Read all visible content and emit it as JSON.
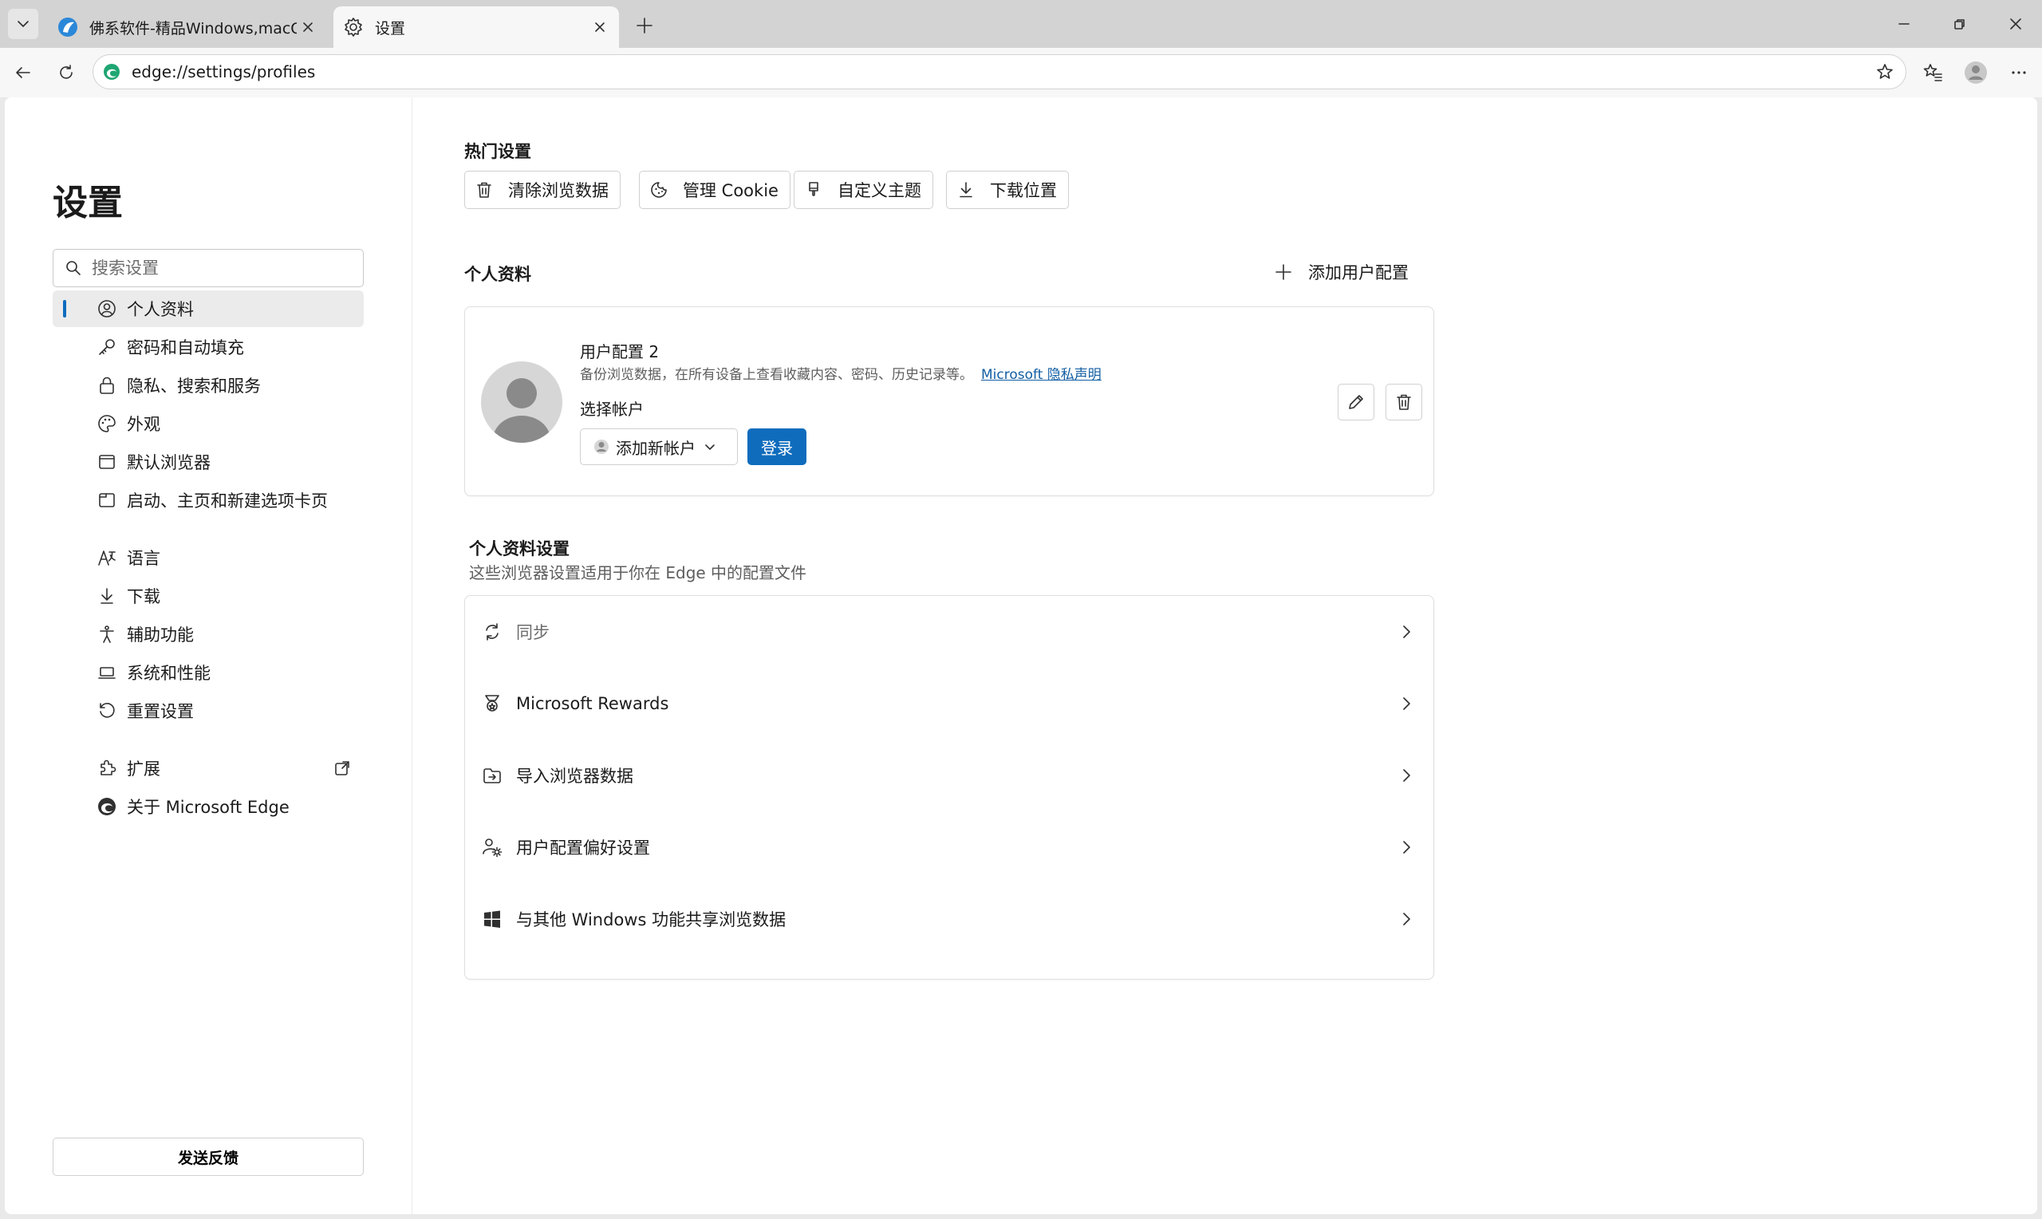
{
  "browser": {
    "tabs": [
      {
        "title": "佛系软件-精品Windows,macOS破解",
        "active": false
      },
      {
        "title": "设置",
        "active": true
      }
    ],
    "address": "edge://settings/profiles"
  },
  "sidebar": {
    "title": "设置",
    "search_placeholder": "搜索设置",
    "items": [
      {
        "label": "个人资料",
        "icon": "profile-icon",
        "active": true
      },
      {
        "label": "密码和自动填充",
        "icon": "key-icon"
      },
      {
        "label": "隐私、搜索和服务",
        "icon": "lock-icon"
      },
      {
        "label": "外观",
        "icon": "palette-icon"
      },
      {
        "label": "默认浏览器",
        "icon": "browser-icon"
      },
      {
        "label": "启动、主页和新建选项卡页",
        "icon": "home-tabs-icon"
      },
      {
        "label": "语言",
        "icon": "language-icon"
      },
      {
        "label": "下载",
        "icon": "download-icon"
      },
      {
        "label": "辅助功能",
        "icon": "accessibility-icon"
      },
      {
        "label": "系统和性能",
        "icon": "laptop-icon"
      },
      {
        "label": "重置设置",
        "icon": "reset-icon"
      },
      {
        "label": "扩展",
        "icon": "puzzle-icon"
      },
      {
        "label": "关于 Microsoft Edge",
        "icon": "edge-logo-icon"
      }
    ],
    "feedback_label": "发送反馈"
  },
  "main": {
    "hot_settings_title": "热门设置",
    "quick_buttons": [
      {
        "label": "清除浏览数据",
        "icon": "trash-icon"
      },
      {
        "label": "管理 Cookie",
        "icon": "cookie-icon"
      },
      {
        "label": "自定义主题",
        "icon": "brush-icon"
      },
      {
        "label": "下载位置",
        "icon": "download-icon"
      }
    ],
    "profiles_title": "个人资料",
    "add_profile_label": "添加用户配置",
    "profile": {
      "name": "用户配置 2",
      "description": "备份浏览数据，在所有设备上查看收藏内容、密码、历史记录等。",
      "privacy_link": "Microsoft 隐私声明",
      "choose_account_label": "选择帐户",
      "account_select": "添加新帐户",
      "signin_label": "登录"
    },
    "profile_settings_title": "个人资料设置",
    "profile_settings_desc": "这些浏览器设置适用于你在 Edge 中的配置文件",
    "settings_rows": [
      {
        "label": "同步",
        "icon": "sync-icon",
        "disabled": true
      },
      {
        "label": "Microsoft Rewards",
        "icon": "rewards-icon"
      },
      {
        "label": "导入浏览器数据",
        "icon": "import-icon"
      },
      {
        "label": "用户配置偏好设置",
        "icon": "people-settings-icon"
      },
      {
        "label": "与其他 Windows 功能共享浏览数据",
        "icon": "windows-icon"
      }
    ]
  },
  "colors": {
    "accent": "#0f6cbd",
    "link": "#115ea3"
  }
}
